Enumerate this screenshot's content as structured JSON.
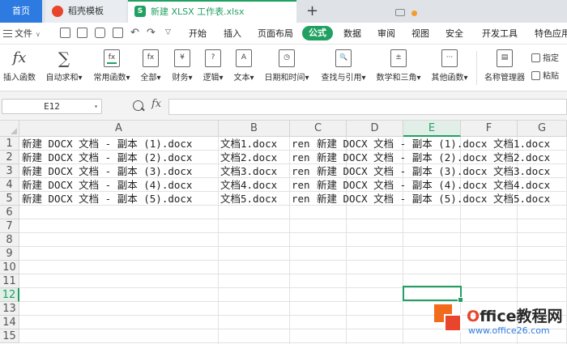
{
  "tabs": {
    "home": "首页",
    "items": [
      {
        "label": "稻壳模板",
        "icon": "docer-icon"
      },
      {
        "label": "新建 XLSX 工作表.xlsx",
        "icon": "spreadsheet-icon",
        "icon_text": "S"
      }
    ],
    "add": "+"
  },
  "menu": {
    "file": "文件",
    "items": [
      "开始",
      "插入",
      "页面布局",
      "公式",
      "数据",
      "审阅",
      "视图",
      "安全",
      "开发工具",
      "特色应用"
    ],
    "active": "公式"
  },
  "ribbon": {
    "buttons": [
      {
        "label": "插入函数",
        "glyph": "fx"
      },
      {
        "label": "自动求和▾",
        "glyph": "∑"
      },
      {
        "label": "常用函数▾",
        "glyph": "fx"
      },
      {
        "label": "全部▾",
        "glyph": "fx"
      },
      {
        "label": "财务▾",
        "glyph": "¥"
      },
      {
        "label": "逻辑▾",
        "glyph": "?"
      },
      {
        "label": "文本▾",
        "glyph": "A"
      },
      {
        "label": "日期和时间▾",
        "glyph": "◷"
      },
      {
        "label": "查找与引用▾",
        "glyph": "🔍"
      },
      {
        "label": "数学和三角▾",
        "glyph": "±"
      },
      {
        "label": "其他函数▾",
        "glyph": "···"
      },
      {
        "label": "名称管理器",
        "glyph": "▤"
      }
    ],
    "side_buttons": [
      "指定",
      "粘贴"
    ]
  },
  "formula_bar": {
    "name_box": "E12",
    "fx": "fx",
    "value": ""
  },
  "grid": {
    "columns": [
      "A",
      "B",
      "C",
      "D",
      "E",
      "F",
      "G"
    ],
    "rows": [
      "1",
      "2",
      "3",
      "4",
      "5",
      "6",
      "7",
      "8",
      "9",
      "10",
      "11",
      "12",
      "13",
      "14",
      "15"
    ],
    "selected_cell": "E12",
    "cells": [
      {
        "a": "新建 DOCX 文档 - 副本 (1).docx",
        "b": "文档1.docx",
        "c": "ren",
        "d": "新建 DOCX 文档 - 副本 (1).docx 文档1.docx"
      },
      {
        "a": "新建 DOCX 文档 - 副本 (2).docx",
        "b": "文档2.docx",
        "c": "ren",
        "d": "新建 DOCX 文档 - 副本 (2).docx 文档2.docx"
      },
      {
        "a": "新建 DOCX 文档 - 副本 (3).docx",
        "b": "文档3.docx",
        "c": "ren",
        "d": "新建 DOCX 文档 - 副本 (3).docx 文档3.docx"
      },
      {
        "a": "新建 DOCX 文档 - 副本 (4).docx",
        "b": "文档4.docx",
        "c": "ren",
        "d": "新建 DOCX 文档 - 副本 (4).docx 文档4.docx"
      },
      {
        "a": "新建 DOCX 文档 - 副本 (5).docx",
        "b": "文档5.docx",
        "c": "ren",
        "d": "新建 DOCX 文档 - 副本 (5).docx 文档5.docx"
      }
    ]
  },
  "watermark": {
    "title_prefix": "O",
    "title_rest": "ffice教程网",
    "url": "www.office26.com"
  },
  "colors": {
    "accent": "#20a162",
    "home_tab": "#2d7be0",
    "watermark_red": "#e8452c"
  }
}
